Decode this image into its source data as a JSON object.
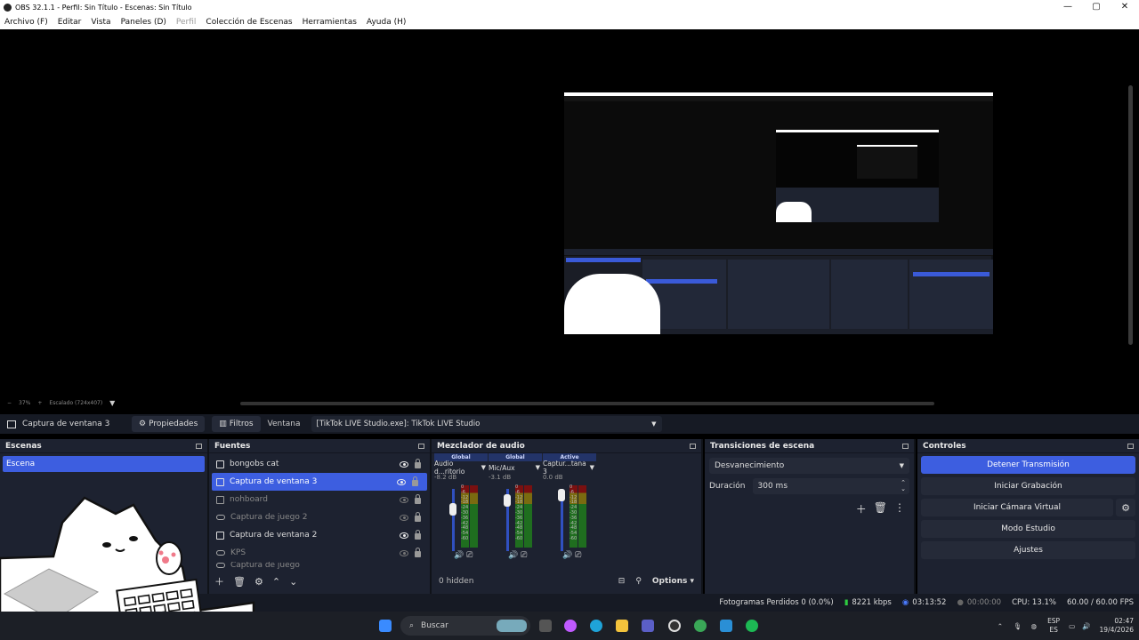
{
  "window": {
    "title": "OBS 32.1.1 - Perfil: Sin Título - Escenas: Sin Título"
  },
  "menu": [
    "Archivo (F)",
    "Editar",
    "Vista",
    "Paneles (D)",
    "Perfil",
    "Colección de Escenas",
    "Herramientas",
    "Ayuda (H)"
  ],
  "preview": {
    "zoom": "37%",
    "scale_label": "Escalado (724x407)"
  },
  "sourcebar": {
    "source_name": "Captura de ventana 3",
    "properties": "Propiedades",
    "filters": "Filtros",
    "window_label": "Ventana",
    "window_value": "[TikTok LIVE Studio.exe]: TikTok LIVE Studio"
  },
  "scenes": {
    "title": "Escenas",
    "items": [
      "Escena"
    ]
  },
  "sources": {
    "title": "Fuentes",
    "items": [
      {
        "name": "bongobs cat",
        "visible": true,
        "icon": "window-icon"
      },
      {
        "name": "Captura de ventana 3",
        "visible": true,
        "icon": "window-icon"
      },
      {
        "name": "nohboard",
        "visible": false,
        "icon": "window-icon"
      },
      {
        "name": "Captura de juego 2",
        "visible": false,
        "icon": "link-icon"
      },
      {
        "name": "Captura de ventana 2",
        "visible": true,
        "icon": "window-icon"
      },
      {
        "name": "KPS",
        "visible": false,
        "icon": "link-icon"
      },
      {
        "name": "Captura de juego",
        "visible": false,
        "icon": "link-icon"
      }
    ]
  },
  "mixer": {
    "title": "Mezclador de audio",
    "channels": [
      {
        "tag": "Global",
        "name": "Audio d...ritorio",
        "db": "-8.2 dB"
      },
      {
        "tag": "Global",
        "name": "Mic/Aux",
        "db": "-3.1 dB"
      },
      {
        "tag": "Active",
        "name": "Captur...tana 3",
        "db": "0.0 dB"
      }
    ],
    "scale": [
      "0",
      "-6",
      "-12",
      "-18",
      "-24",
      "-30",
      "-36",
      "-42",
      "-48",
      "-54",
      "-60"
    ],
    "hidden": "0 hidden",
    "options": "Options"
  },
  "transitions": {
    "title": "Transiciones de escena",
    "type": "Desvanecimiento",
    "duration_label": "Duración",
    "duration_value": "300 ms"
  },
  "controls": {
    "title": "Controles",
    "stop_stream": "Detener Transmisión",
    "start_recording": "Iniciar Grabación",
    "start_vcam": "Iniciar Cámara Virtual",
    "studio_mode": "Modo Estudio",
    "settings": "Ajustes"
  },
  "status": {
    "dropped": "Fotogramas Perdidos 0 (0.0%)",
    "bitrate": "8221 kbps",
    "stream_time": "03:13:52",
    "rec_time": "00:00:00",
    "cpu": "CPU: 13.1%",
    "fps": "60.00 / 60.00 FPS"
  },
  "taskbar": {
    "search": "Buscar",
    "lang1": "ESP",
    "lang2": "ES",
    "time": "02:47",
    "date": "19/4/2026"
  },
  "colors": {
    "accent": "#3d5ee0",
    "dock_bg": "#1d2230"
  }
}
